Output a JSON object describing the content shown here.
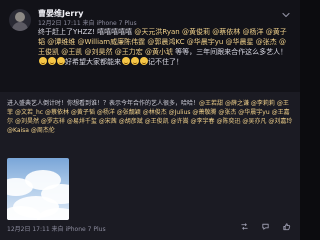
{
  "post": {
    "author": "曹晏维Jerry",
    "meta": "12月2日 17:11 来自 iPhone 7 Plus",
    "text_parts": [
      {
        "t": "终于赶上了YHZZ! 嘻嘻嘻嘻嘻 ",
        "m": false
      },
      {
        "t": "@天元洪Ryan",
        "m": true
      },
      {
        "t": " ",
        "m": false
      },
      {
        "t": "@黄俊莉",
        "m": true
      },
      {
        "t": " ",
        "m": false
      },
      {
        "t": "@蔡依林",
        "m": true
      },
      {
        "t": " ",
        "m": false
      },
      {
        "t": "@杨洋",
        "m": true
      },
      {
        "t": " ",
        "m": false
      },
      {
        "t": "@黄子韬",
        "m": true
      },
      {
        "t": " ",
        "m": false
      },
      {
        "t": "@谭维维",
        "m": true
      },
      {
        "t": " ",
        "m": false
      },
      {
        "t": "@William威廉陈伟霆",
        "m": true
      },
      {
        "t": " ",
        "m": false
      },
      {
        "t": "@郭晨鸿KC",
        "m": true
      },
      {
        "t": " ",
        "m": false
      },
      {
        "t": "@华晨宇yu",
        "m": true
      },
      {
        "t": " ",
        "m": false
      },
      {
        "t": "@华晨星",
        "m": true
      },
      {
        "t": " ",
        "m": false
      },
      {
        "t": "@张杰",
        "m": true
      },
      {
        "t": " ",
        "m": false
      },
      {
        "t": "@王俊凯",
        "m": true
      },
      {
        "t": " ",
        "m": false
      },
      {
        "t": "@王凯",
        "m": true
      },
      {
        "t": " ",
        "m": false
      },
      {
        "t": "@刘昊然",
        "m": true
      },
      {
        "t": " ",
        "m": false
      },
      {
        "t": "@王力宏",
        "m": true
      },
      {
        "t": " ",
        "m": false
      },
      {
        "t": "@黄小琥",
        "m": true
      },
      {
        "t": " 等等，三年间跟来合作这么多艺人！",
        "m": false
      },
      {
        "t": "好希望大家都能来",
        "m": false
      },
      {
        "t": "记不住了！",
        "m": false
      }
    ]
  },
  "forward": {
    "text_parts": [
      {
        "t": "进入盛典艺人倒计时！你想看到谁！？表示今年合作的艺人很多，哈哈！",
        "m": false
      },
      {
        "t": "@王若甜",
        "m": true
      },
      {
        "t": " ",
        "m": false
      },
      {
        "t": "@薛之谦",
        "m": true
      },
      {
        "t": " ",
        "m": false
      },
      {
        "t": "@李莉莉",
        "m": true
      },
      {
        "t": " ",
        "m": false
      },
      {
        "t": "@王菲",
        "m": true
      },
      {
        "t": " ",
        "m": false
      },
      {
        "t": "@文若_hc",
        "m": true
      },
      {
        "t": " ",
        "m": false
      },
      {
        "t": "@蔡依林",
        "m": true
      },
      {
        "t": " ",
        "m": false
      },
      {
        "t": "@黄子韬",
        "m": true
      },
      {
        "t": " ",
        "m": false
      },
      {
        "t": "@杨洋",
        "m": true
      },
      {
        "t": " ",
        "m": false
      },
      {
        "t": "@张靓颖",
        "m": true
      },
      {
        "t": " ",
        "m": false
      },
      {
        "t": "@林俊杰",
        "m": true
      },
      {
        "t": " ",
        "m": false
      },
      {
        "t": "@Julius",
        "m": true
      },
      {
        "t": " ",
        "m": false
      },
      {
        "t": "@萧敬腾",
        "m": true
      },
      {
        "t": " ",
        "m": false
      },
      {
        "t": "@张杰",
        "m": true
      },
      {
        "t": " ",
        "m": false
      },
      {
        "t": "@华晨宇yu",
        "m": true
      },
      {
        "t": " ",
        "m": false
      },
      {
        "t": "@王嘉尔",
        "m": true
      },
      {
        "t": " ",
        "m": false
      },
      {
        "t": "@刘昊然",
        "m": true
      },
      {
        "t": " ",
        "m": false
      },
      {
        "t": "@罗志祥",
        "m": true
      },
      {
        "t": " ",
        "m": false
      },
      {
        "t": "@易烊千玺",
        "m": true
      },
      {
        "t": " ",
        "m": false
      },
      {
        "t": "@宋茜",
        "m": true
      },
      {
        "t": " ",
        "m": false
      },
      {
        "t": "@胡彦斌",
        "m": true
      },
      {
        "t": " ",
        "m": false
      },
      {
        "t": "@王俊凯",
        "m": true
      },
      {
        "t": " ",
        "m": false
      },
      {
        "t": "@许嵩",
        "m": true
      },
      {
        "t": " ",
        "m": false
      },
      {
        "t": "@李宇春",
        "m": true
      },
      {
        "t": " ",
        "m": false
      },
      {
        "t": "@陈奕迅",
        "m": true
      },
      {
        "t": " ",
        "m": false
      },
      {
        "t": "@吴亦凡",
        "m": true
      },
      {
        "t": " ",
        "m": false
      },
      {
        "t": "@刘嘉玲",
        "m": true
      },
      {
        "t": " ",
        "m": false
      },
      {
        "t": "@Kaisa",
        "m": true
      },
      {
        "t": " ",
        "m": false
      },
      {
        "t": "@周杰伦",
        "m": true
      }
    ],
    "date": "12月2日 17:11 来自 iPhone 7 Plus"
  },
  "icons": {
    "chevron": "chevron-down-icon",
    "repost": "repost-icon",
    "comment": "comment-icon",
    "like": "like-icon"
  },
  "colors": {
    "mention": "#f2d28b",
    "background": "#0c0c0f",
    "forward_background": "#1b1b23"
  }
}
